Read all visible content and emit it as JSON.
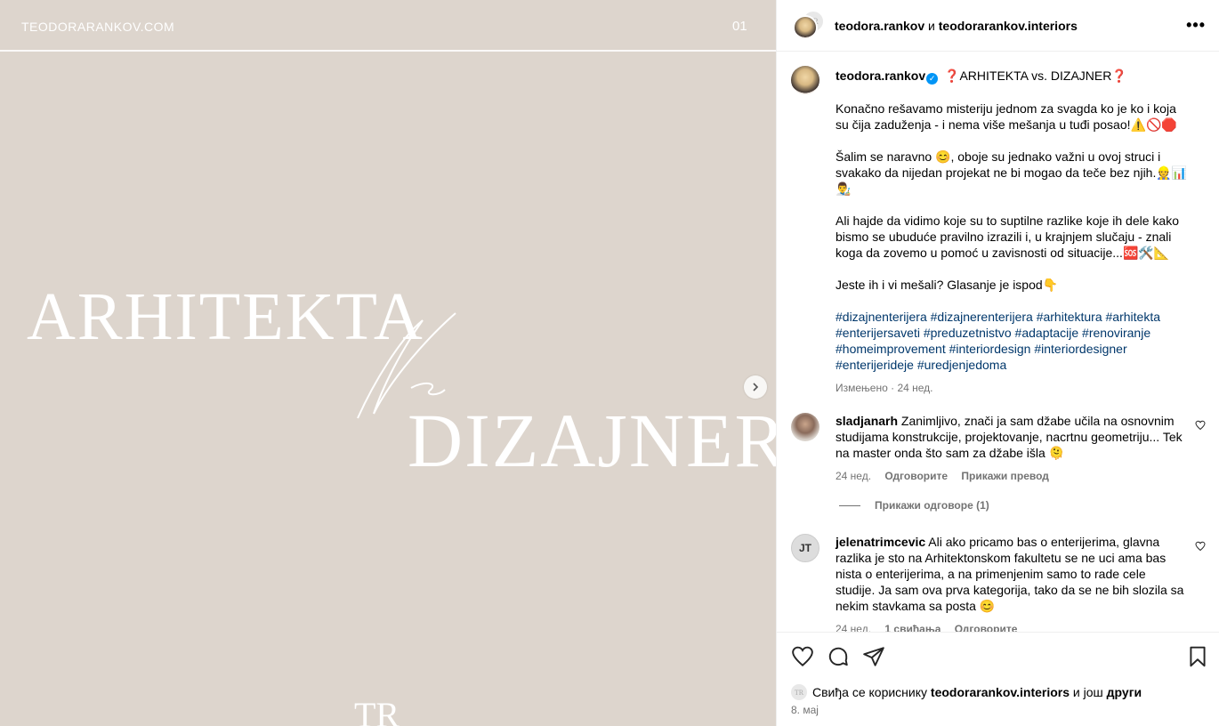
{
  "image": {
    "site": "TEODORARANKOV.COM",
    "page_number": "01",
    "title_line1": "ARHITEKTA",
    "title_line2": "DIZAJNER",
    "monogram": "TR",
    "next_icon": "chevron-right-icon"
  },
  "header": {
    "user1": "teodora.rankov",
    "conjunction": "и",
    "user2": "teodorarankov.interiors",
    "more_icon": "more-horizontal-icon"
  },
  "caption": {
    "username": "teodora.rankov",
    "title": "❓ARHITEKTA vs. DIZAJNER❓",
    "p1": "Konačno rešavamo misteriju jednom za svagda ko je ko i koja su čija zaduženja - i nema više mešanja u tuđi posao!⚠️🚫🛑",
    "p2": "Šalim se naravno 😊, oboje su jednako važni u ovoj struci i svakako da nijedan projekat ne bi mogao da teče bez njih.👷📊👨‍🎨",
    "p3": "Ali hajde da vidimo koje su to suptilne razlike koje ih dele kako bismo se ubuduće pravilno izrazili i, u krajnjem slučaju - znali koga da zovemo u pomoć u zavisnosti od situacije...🆘🛠️📐",
    "p4": "Jeste ih i vi mešali? Glasanje je ispod👇",
    "hashtags": "#dizajnenterijera #dizajnerenterijera #arhitektura #arhitekta #enterijersaveti #preduzetnistvo #adaptacije #renoviranje #homeimprovement #interiordesign #interiordesigner #enterijerideje #uredjenjedoma",
    "meta": "Измењено · 24 нед."
  },
  "comments": [
    {
      "username": "sladjanarh",
      "text": "Zanimljivo, znači ja sam džabe učila na osnovnim studijama konstrukcije, projektovanje, nacrtnu geometriju... Tek na master onda što sam za džabe išla 🫠",
      "time": "24 нед.",
      "reply": "Одговорите",
      "translate": "Прикажи превод"
    },
    {
      "username": "jelenatrimcevic",
      "text": "Ali ako pricamo bas o enterijerima, glavna razlika je sto na Arhitektonskom fakultetu se ne uci ama bas nista o enterijerima, a na primenjenim samo to rade cele studije. Ja sam ova prva kategorija, tako da se ne bih slozila sa nekim stavkama sa posta 😊",
      "time": "24 нед.",
      "likes": "1 свиђања",
      "reply": "Одговорите"
    }
  ],
  "view_replies": "Прикажи одговоре (1)",
  "actions": {
    "like_icon": "heart-icon",
    "comment_icon": "comment-icon",
    "share_icon": "share-icon",
    "save_icon": "bookmark-icon"
  },
  "likes": {
    "prefix": "Свиђа се кориснику",
    "user": "teodorarankov.interiors",
    "middle": "и још",
    "others": "други"
  },
  "date": "8. мај"
}
